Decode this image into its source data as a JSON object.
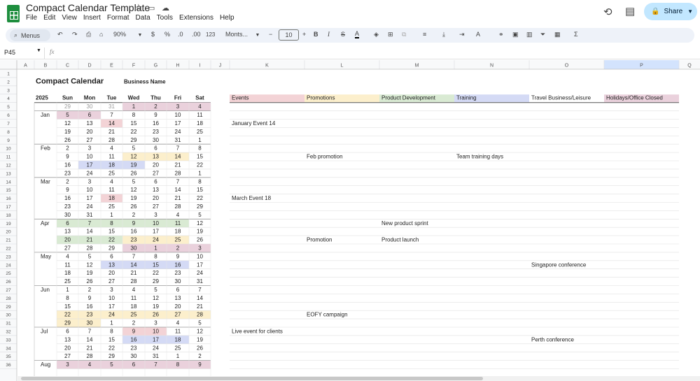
{
  "doc": {
    "title": "Compact Calendar Template",
    "menus": [
      "File",
      "Edit",
      "View",
      "Insert",
      "Format",
      "Data",
      "Tools",
      "Extensions",
      "Help"
    ],
    "share_label": "Share"
  },
  "toolbar": {
    "menus_label": "Menus",
    "zoom": "90%",
    "currency": "$",
    "percent": "%",
    "dec_dec": ".0",
    "inc_dec": ".00",
    "number_format": "123",
    "font": "Monts...",
    "font_size": "10",
    "minus": "−",
    "plus": "+"
  },
  "formula": {
    "cell_ref": "P45",
    "fx": "fx"
  },
  "columns": [
    "A",
    "B",
    "C",
    "D",
    "E",
    "F",
    "G",
    "H",
    "I",
    "J",
    "K",
    "L",
    "M",
    "N",
    "O",
    "P",
    "Q"
  ],
  "rows": [
    "1",
    "2",
    "3",
    "4",
    "5",
    "6",
    "7",
    "8",
    "9",
    "10",
    "11",
    "12",
    "13",
    "14",
    "15",
    "16",
    "17",
    "18",
    "19",
    "20",
    "21",
    "22",
    "23",
    "24",
    "25",
    "26",
    "27",
    "28",
    "29",
    "30",
    "31",
    "32",
    "33",
    "34",
    "35",
    "36"
  ],
  "calendar": {
    "title": "Compact Calendar",
    "business": "Business Name",
    "year": "2025",
    "weekdays": [
      "Sun",
      "Mon",
      "Tue",
      "Wed",
      "Thu",
      "Fri",
      "Sat"
    ],
    "legend": [
      "Events",
      "Promotions",
      "Product Development",
      "Training",
      "Travel Business/Leisure",
      "Holidays/Office Closed"
    ],
    "legend_colors": [
      "#f3d3d6",
      "#fcefcc",
      "#d9ead3",
      "#d4daf5",
      "#ffffff",
      "#ead1dc"
    ],
    "weeks": [
      {
        "month": "",
        "days": [
          "29",
          "30",
          "31",
          "1",
          "2",
          "3",
          "4"
        ]
      },
      {
        "month": "Jan",
        "days": [
          "5",
          "6",
          "7",
          "8",
          "9",
          "10",
          "11"
        ]
      },
      {
        "month": "",
        "days": [
          "12",
          "13",
          "14",
          "15",
          "16",
          "17",
          "18"
        ]
      },
      {
        "month": "",
        "days": [
          "19",
          "20",
          "21",
          "22",
          "23",
          "24",
          "25"
        ]
      },
      {
        "month": "",
        "days": [
          "26",
          "27",
          "28",
          "29",
          "30",
          "31",
          "1"
        ]
      },
      {
        "month": "Feb",
        "days": [
          "2",
          "3",
          "4",
          "5",
          "6",
          "7",
          "8"
        ]
      },
      {
        "month": "",
        "days": [
          "9",
          "10",
          "11",
          "12",
          "13",
          "14",
          "15"
        ]
      },
      {
        "month": "",
        "days": [
          "16",
          "17",
          "18",
          "19",
          "20",
          "21",
          "22"
        ]
      },
      {
        "month": "",
        "days": [
          "23",
          "24",
          "25",
          "26",
          "27",
          "28",
          "1"
        ]
      },
      {
        "month": "Mar",
        "days": [
          "2",
          "3",
          "4",
          "5",
          "6",
          "7",
          "8"
        ]
      },
      {
        "month": "",
        "days": [
          "9",
          "10",
          "11",
          "12",
          "13",
          "14",
          "15"
        ]
      },
      {
        "month": "",
        "days": [
          "16",
          "17",
          "18",
          "19",
          "20",
          "21",
          "22"
        ]
      },
      {
        "month": "",
        "days": [
          "23",
          "24",
          "25",
          "26",
          "27",
          "28",
          "29"
        ]
      },
      {
        "month": "",
        "days": [
          "30",
          "31",
          "1",
          "2",
          "3",
          "4",
          "5"
        ]
      },
      {
        "month": "Apr",
        "days": [
          "6",
          "7",
          "8",
          "9",
          "10",
          "11",
          "12"
        ]
      },
      {
        "month": "",
        "days": [
          "13",
          "14",
          "15",
          "16",
          "17",
          "18",
          "19"
        ]
      },
      {
        "month": "",
        "days": [
          "20",
          "21",
          "22",
          "23",
          "24",
          "25",
          "26"
        ]
      },
      {
        "month": "",
        "days": [
          "27",
          "28",
          "29",
          "30",
          "1",
          "2",
          "3"
        ]
      },
      {
        "month": "May",
        "days": [
          "4",
          "5",
          "6",
          "7",
          "8",
          "9",
          "10"
        ]
      },
      {
        "month": "",
        "days": [
          "11",
          "12",
          "13",
          "14",
          "15",
          "16",
          "17"
        ]
      },
      {
        "month": "",
        "days": [
          "18",
          "19",
          "20",
          "21",
          "22",
          "23",
          "24"
        ]
      },
      {
        "month": "",
        "days": [
          "25",
          "26",
          "27",
          "28",
          "29",
          "30",
          "31"
        ]
      },
      {
        "month": "Jun",
        "days": [
          "1",
          "2",
          "3",
          "4",
          "5",
          "6",
          "7"
        ]
      },
      {
        "month": "",
        "days": [
          "8",
          "9",
          "10",
          "11",
          "12",
          "13",
          "14"
        ]
      },
      {
        "month": "",
        "days": [
          "15",
          "16",
          "17",
          "18",
          "19",
          "20",
          "21"
        ]
      },
      {
        "month": "",
        "days": [
          "22",
          "23",
          "24",
          "25",
          "26",
          "27",
          "28"
        ]
      },
      {
        "month": "",
        "days": [
          "29",
          "30",
          "1",
          "2",
          "3",
          "4",
          "5"
        ]
      },
      {
        "month": "Jul",
        "days": [
          "6",
          "7",
          "8",
          "9",
          "10",
          "11",
          "12"
        ]
      },
      {
        "month": "",
        "days": [
          "13",
          "14",
          "15",
          "16",
          "17",
          "18",
          "19"
        ]
      },
      {
        "month": "",
        "days": [
          "20",
          "21",
          "22",
          "23",
          "24",
          "25",
          "26"
        ]
      },
      {
        "month": "",
        "days": [
          "27",
          "28",
          "29",
          "30",
          "31",
          "1",
          "2"
        ]
      },
      {
        "month": "Aug",
        "days": [
          "3",
          "4",
          "5",
          "6",
          "7",
          "8",
          "9"
        ]
      }
    ],
    "highlights": [
      {
        "w": 0,
        "d": 3,
        "c": "#ead1dc"
      },
      {
        "w": 0,
        "d": 4,
        "c": "#ead1dc"
      },
      {
        "w": 0,
        "d": 5,
        "c": "#ead1dc"
      },
      {
        "w": 0,
        "d": 6,
        "c": "#ead1dc"
      },
      {
        "w": 1,
        "d": 0,
        "c": "#ead1dc"
      },
      {
        "w": 1,
        "d": 1,
        "c": "#ead1dc"
      },
      {
        "w": 2,
        "d": 2,
        "c": "#f3d3d6"
      },
      {
        "w": 6,
        "d": 3,
        "c": "#fcefcc"
      },
      {
        "w": 6,
        "d": 4,
        "c": "#fcefcc"
      },
      {
        "w": 6,
        "d": 5,
        "c": "#fcefcc"
      },
      {
        "w": 7,
        "d": 1,
        "c": "#d4daf5"
      },
      {
        "w": 7,
        "d": 2,
        "c": "#d4daf5"
      },
      {
        "w": 7,
        "d": 3,
        "c": "#d4daf5"
      },
      {
        "w": 11,
        "d": 2,
        "c": "#f3d3d6"
      },
      {
        "w": 14,
        "d": 0,
        "c": "#d9ead3"
      },
      {
        "w": 14,
        "d": 1,
        "c": "#d9ead3"
      },
      {
        "w": 14,
        "d": 2,
        "c": "#d9ead3"
      },
      {
        "w": 14,
        "d": 3,
        "c": "#d9ead3"
      },
      {
        "w": 14,
        "d": 4,
        "c": "#d9ead3"
      },
      {
        "w": 14,
        "d": 5,
        "c": "#d9ead3"
      },
      {
        "w": 16,
        "d": 0,
        "c": "#d9ead3"
      },
      {
        "w": 16,
        "d": 1,
        "c": "#d9ead3"
      },
      {
        "w": 16,
        "d": 2,
        "c": "#d9ead3"
      },
      {
        "w": 16,
        "d": 3,
        "c": "#fcefcc"
      },
      {
        "w": 16,
        "d": 4,
        "c": "#fcefcc"
      },
      {
        "w": 16,
        "d": 5,
        "c": "#fcefcc"
      },
      {
        "w": 17,
        "d": 3,
        "c": "#ead1dc"
      },
      {
        "w": 17,
        "d": 4,
        "c": "#ead1dc"
      },
      {
        "w": 17,
        "d": 5,
        "c": "#ead1dc"
      },
      {
        "w": 17,
        "d": 6,
        "c": "#ead1dc"
      },
      {
        "w": 19,
        "d": 2,
        "c": "#d4daf5"
      },
      {
        "w": 19,
        "d": 3,
        "c": "#d4daf5"
      },
      {
        "w": 19,
        "d": 4,
        "c": "#d4daf5"
      },
      {
        "w": 19,
        "d": 5,
        "c": "#d4daf5"
      },
      {
        "w": 25,
        "d": 0,
        "c": "#fcefcc"
      },
      {
        "w": 25,
        "d": 1,
        "c": "#fcefcc"
      },
      {
        "w": 25,
        "d": 2,
        "c": "#fcefcc"
      },
      {
        "w": 25,
        "d": 3,
        "c": "#fcefcc"
      },
      {
        "w": 25,
        "d": 4,
        "c": "#fcefcc"
      },
      {
        "w": 25,
        "d": 5,
        "c": "#fcefcc"
      },
      {
        "w": 25,
        "d": 6,
        "c": "#fcefcc"
      },
      {
        "w": 26,
        "d": 0,
        "c": "#fcefcc"
      },
      {
        "w": 26,
        "d": 1,
        "c": "#fcefcc"
      },
      {
        "w": 27,
        "d": 3,
        "c": "#f3d3d6"
      },
      {
        "w": 27,
        "d": 4,
        "c": "#f3d3d6"
      },
      {
        "w": 28,
        "d": 3,
        "c": "#d4daf5"
      },
      {
        "w": 28,
        "d": 4,
        "c": "#d4daf5"
      },
      {
        "w": 28,
        "d": 5,
        "c": "#d4daf5"
      },
      {
        "w": 31,
        "d": 0,
        "c": "#ead1dc"
      },
      {
        "w": 31,
        "d": 1,
        "c": "#ead1dc"
      },
      {
        "w": 31,
        "d": 2,
        "c": "#ead1dc"
      },
      {
        "w": 31,
        "d": 3,
        "c": "#ead1dc"
      },
      {
        "w": 31,
        "d": 4,
        "c": "#ead1dc"
      },
      {
        "w": 31,
        "d": 5,
        "c": "#ead1dc"
      },
      {
        "w": 31,
        "d": 6,
        "c": "#ead1dc"
      }
    ],
    "notes": [
      {
        "w": 2,
        "col": 0,
        "text": "January Event 14"
      },
      {
        "w": 6,
        "col": 1,
        "text": "Feb promotion"
      },
      {
        "w": 6,
        "col": 3,
        "text": "Team training days"
      },
      {
        "w": 11,
        "col": 0,
        "text": "March Event 18"
      },
      {
        "w": 14,
        "col": 2,
        "text": "New product sprint"
      },
      {
        "w": 16,
        "col": 1,
        "text": "Promotion"
      },
      {
        "w": 16,
        "col": 2,
        "text": "Product launch"
      },
      {
        "w": 19,
        "col": 4,
        "text": "Singapore conference"
      },
      {
        "w": 25,
        "col": 1,
        "text": "EOFY campaign"
      },
      {
        "w": 27,
        "col": 0,
        "text": "Live event for clients"
      },
      {
        "w": 28,
        "col": 4,
        "text": "Perth conference"
      }
    ]
  }
}
